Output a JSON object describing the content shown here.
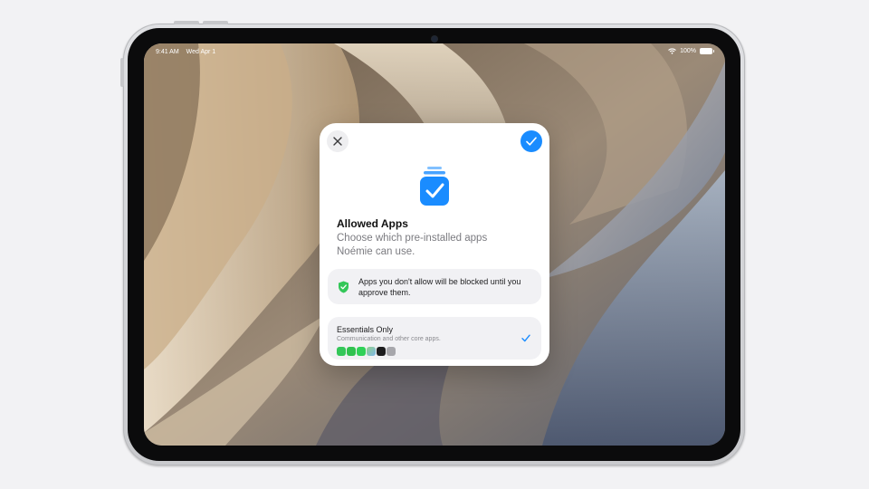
{
  "status_bar": {
    "time": "9:41 AM",
    "date": "Wed Apr 1",
    "battery": "100%"
  },
  "sheet": {
    "close_icon": "xmark-icon",
    "done_icon": "checkmark-icon",
    "hero_icon": "app-stack-checkmark-icon",
    "title": "Allowed Apps",
    "subtitle": "Choose which pre-installed apps Noémie can use.",
    "notice": {
      "icon": "shield-checkmark-icon",
      "text": "Apps you don't allow will be blocked until you approve them."
    },
    "option": {
      "name": "Essentials Only",
      "description": "Communication and other core apps.",
      "selected": true,
      "app_icons": [
        {
          "name": "phone-app-icon",
          "color": "#34c759"
        },
        {
          "name": "facetime-app-icon",
          "color": "#30c24f"
        },
        {
          "name": "messages-app-icon",
          "color": "#30d158"
        },
        {
          "name": "maps-app-icon",
          "color": "#7fb5e8"
        },
        {
          "name": "clock-app-icon",
          "color": "#1c1c1e"
        },
        {
          "name": "settings-app-icon",
          "color": "#a7a7ac"
        }
      ]
    }
  },
  "colors": {
    "accent": "#1a8cff",
    "shield": "#34c759"
  }
}
